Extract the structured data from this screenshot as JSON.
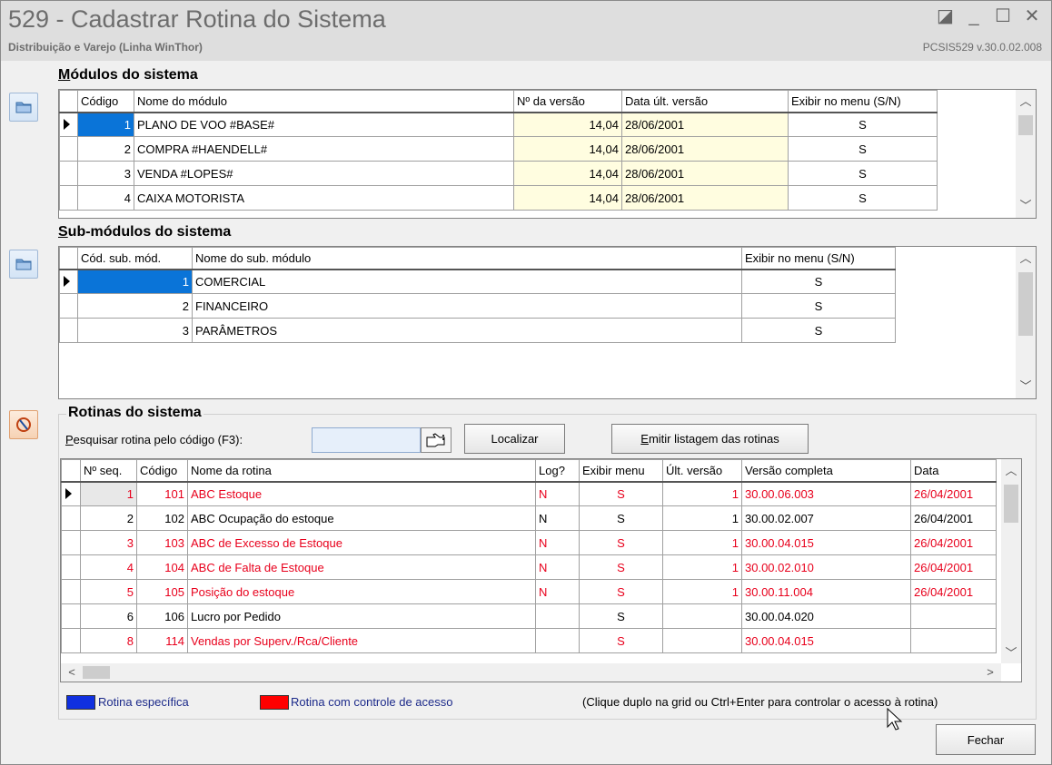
{
  "window": {
    "title": "529 - Cadastrar Rotina do Sistema",
    "subtitle": "Distribuição e Varejo (Linha WinThor)",
    "version": "PCSIS529  v.30.0.02.008",
    "controls": [
      "◪",
      "_",
      "☐",
      "✕"
    ]
  },
  "modulos": {
    "label_first": "M",
    "label_rest": "ódulos do sistema",
    "columns": [
      "Código",
      "Nome do módulo",
      "Nº da versão",
      "Data últ. versão",
      "Exibir no menu (S/N)"
    ],
    "rows": [
      {
        "codigo": "1",
        "nome": "PLANO DE VOO      #BASE#",
        "versao": "14,04",
        "data": "28/06/2001",
        "exibir": "S"
      },
      {
        "codigo": "2",
        "nome": "COMPRA           #HAENDELL#",
        "versao": "14,04",
        "data": "28/06/2001",
        "exibir": "S"
      },
      {
        "codigo": "3",
        "nome": "VENDA              #LOPES#",
        "versao": "14,04",
        "data": "28/06/2001",
        "exibir": "S"
      },
      {
        "codigo": "4",
        "nome": "CAIXA MOTORISTA",
        "versao": "14,04",
        "data": "28/06/2001",
        "exibir": "S"
      }
    ]
  },
  "submodulos": {
    "label_first": "S",
    "label_rest": "ub-módulos do sistema",
    "columns": [
      "Cód. sub. mód.",
      "Nome do sub. módulo",
      "Exibir no menu (S/N)"
    ],
    "rows": [
      {
        "codigo": "1",
        "nome": "COMERCIAL",
        "exibir": "S"
      },
      {
        "codigo": "2",
        "nome": "FINANCEIRO",
        "exibir": "S"
      },
      {
        "codigo": "3",
        "nome": "PARÂMETROS",
        "exibir": "S"
      }
    ]
  },
  "rotinas": {
    "label": "Rotinas do sistema",
    "search_label_first": "P",
    "search_label_rest": "esquisar rotina pelo código (F3):",
    "search_value": "",
    "localizar_label": "Localizar",
    "emitir_label_first": "E",
    "emitir_label_rest": "mitir listagem das rotinas",
    "columns": [
      "Nº seq.",
      "Código",
      "Nome da rotina",
      "Log?",
      "Exibir menu",
      "Últ. versão",
      "Versão completa",
      "Data"
    ],
    "rows": [
      {
        "seq": "1",
        "codigo": "101",
        "nome": "ABC Estoque",
        "log": "N",
        "exibir": "S",
        "ult": "1",
        "completa": "30.00.06.003",
        "data": "26/04/2001",
        "red": true
      },
      {
        "seq": "2",
        "codigo": "102",
        "nome": "ABC Ocupação do estoque",
        "log": "N",
        "exibir": "S",
        "ult": "1",
        "completa": "30.00.02.007",
        "data": "26/04/2001",
        "red": false
      },
      {
        "seq": "3",
        "codigo": "103",
        "nome": "ABC de Excesso de Estoque",
        "log": "N",
        "exibir": "S",
        "ult": "1",
        "completa": "30.00.04.015",
        "data": "26/04/2001",
        "red": true
      },
      {
        "seq": "4",
        "codigo": "104",
        "nome": "ABC de Falta de Estoque",
        "log": "N",
        "exibir": "S",
        "ult": "1",
        "completa": "30.00.02.010",
        "data": "26/04/2001",
        "red": true
      },
      {
        "seq": "5",
        "codigo": "105",
        "nome": "Posição do estoque",
        "log": "N",
        "exibir": "S",
        "ult": "1",
        "completa": "30.00.11.004",
        "data": "26/04/2001",
        "red": true
      },
      {
        "seq": "6",
        "codigo": "106",
        "nome": "Lucro por Pedido",
        "log": "",
        "exibir": "S",
        "ult": "",
        "completa": "30.00.04.020",
        "data": "",
        "red": false
      },
      {
        "seq": "8",
        "codigo": "114",
        "nome": "Vendas por Superv./Rca/Cliente",
        "log": "",
        "exibir": "S",
        "ult": "",
        "completa": "30.00.04.015",
        "data": "",
        "red": true
      }
    ]
  },
  "legend": {
    "especifica": "Rotina específica",
    "controle": "Rotina com controle de acesso",
    "hint": "(Clique duplo na grid ou Ctrl+Enter para controlar o acesso à rotina)",
    "blue": "#1030e0",
    "red": "#ff0000"
  },
  "fechar_label": "Fechar",
  "colors": {
    "selection": "#0a74d8",
    "red_text": "#e8001c",
    "version_bg": "#fffde0"
  }
}
